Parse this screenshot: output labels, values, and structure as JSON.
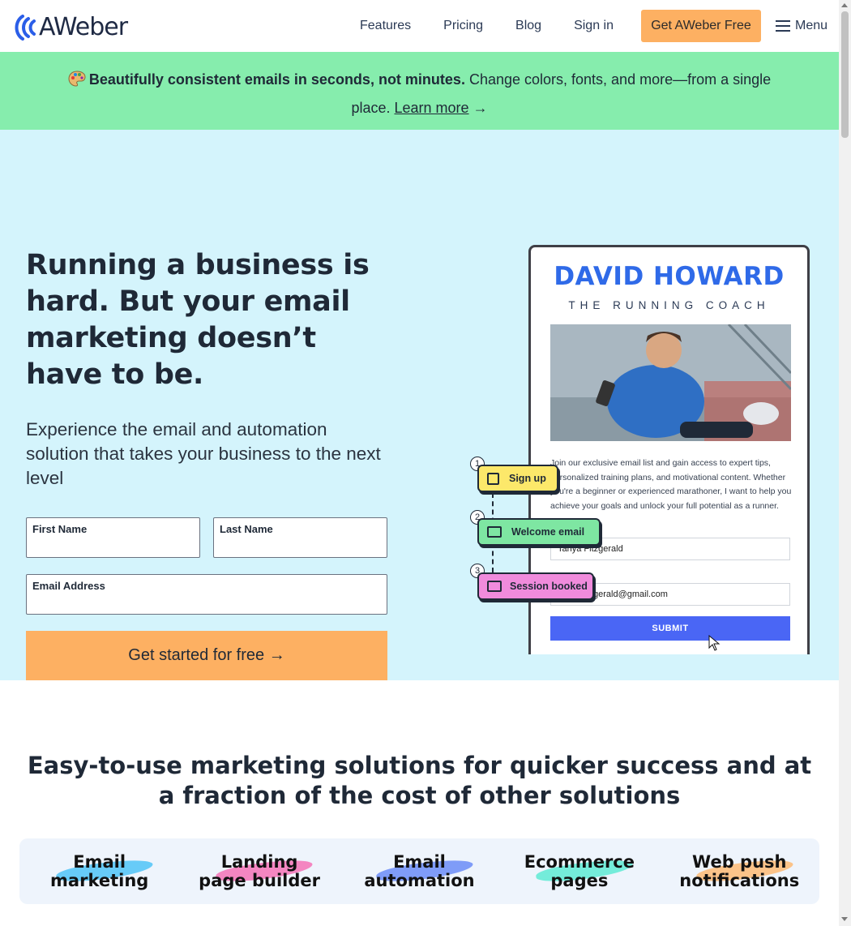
{
  "header": {
    "logo_text": "AWeber",
    "nav": [
      "Features",
      "Pricing",
      "Blog",
      "Sign in"
    ],
    "cta_label": "Get AWeber Free",
    "menu_label": "Menu"
  },
  "banner": {
    "bold": "Beautifully consistent emails in seconds, not minutes.",
    "text": " Change colors, fonts, and more—from a single place. ",
    "link": "Learn more",
    "arrow": "→"
  },
  "hero": {
    "title": "Running a business is hard. But your email marketing doesn’t have to be.",
    "subtitle": "Experience the email and automation solution that takes your business to the next level",
    "first_name_label": "First Name",
    "last_name_label": "Last Name",
    "email_label": "Email Address",
    "submit_label": "Get started for free →"
  },
  "preview": {
    "name": "DAVID HOWARD",
    "role": "THE RUNNING COACH",
    "text": "Join our exclusive email list and gain access to expert tips, personalized training plans, and motivational content. Whether you're a beginner or experienced marathoner, I want to help you achieve your goals and unlock your full potential as a runner.",
    "name_value": "Tanya Fitzgerald",
    "email_value": "tanya.fitzgerald@gmail.com",
    "submit": "SUBMIT",
    "steps": [
      {
        "num": "1",
        "label": "Sign up"
      },
      {
        "num": "2",
        "label": "Welcome email"
      },
      {
        "num": "3",
        "label": "Session booked"
      }
    ]
  },
  "solutions": {
    "title": "Easy-to-use marketing solutions for quicker success and at a fraction of the cost of other solutions",
    "items": [
      {
        "line1": "Email",
        "line2": "marketing",
        "color": "#4fc3f7"
      },
      {
        "line1": "Landing",
        "line2": "page builder",
        "color": "#f472b6"
      },
      {
        "line1": "Email",
        "line2": "automation",
        "color": "#6b8cf7"
      },
      {
        "line1": "Ecommerce",
        "line2": "pages",
        "color": "#5eead4"
      },
      {
        "line1": "Web push",
        "line2": "notifications",
        "color": "#fdba74"
      }
    ]
  }
}
